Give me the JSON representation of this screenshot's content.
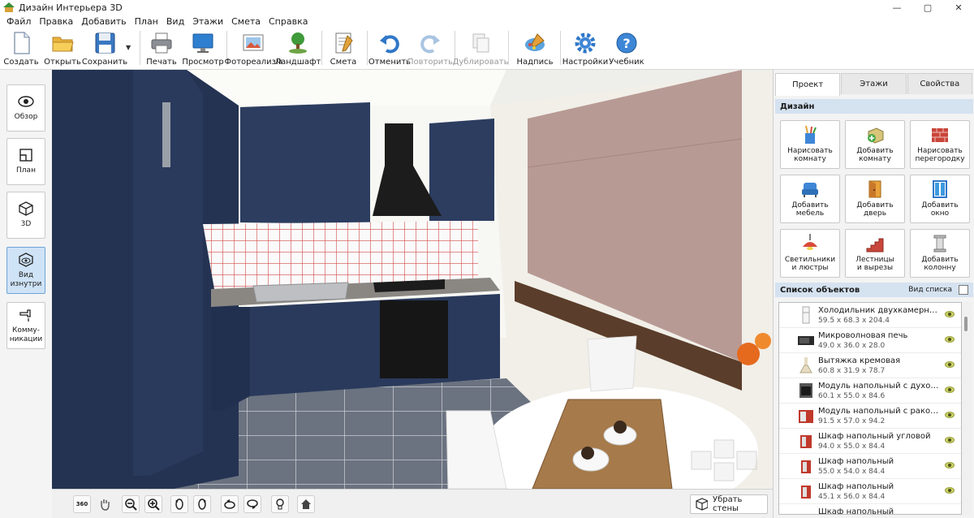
{
  "window": {
    "title": "Дизайн Интерьера 3D",
    "controls": [
      "—",
      "▢",
      "✕"
    ]
  },
  "menu": [
    "Файл",
    "Правка",
    "Добавить",
    "План",
    "Вид",
    "Этажи",
    "Смета",
    "Справка"
  ],
  "toolbar": {
    "create": "Создать",
    "open": "Открыть",
    "save": "Сохранить",
    "print": "Печать",
    "preview": "Просмотр",
    "photorealism": "Фотореализм",
    "landscape": "Ландшафт",
    "estimate": "Смета",
    "undo": "Отменить",
    "redo": "Повторить",
    "duplicate": "Дублировать",
    "caption": "Надпись",
    "settings": "Настройки",
    "tutorial": "Учебник"
  },
  "sidebar": {
    "items": [
      {
        "label": "Обзор",
        "icon": "eye-icon"
      },
      {
        "label": "План",
        "icon": "plan-icon"
      },
      {
        "label": "3D",
        "icon": "cube-icon"
      },
      {
        "label": "Вид\nизнутри",
        "icon": "inside-view-icon",
        "active": true
      },
      {
        "label": "Комму-\nникации",
        "icon": "faucet-icon"
      }
    ]
  },
  "panel": {
    "tabs": [
      "Проект",
      "Этажи",
      "Свойства"
    ],
    "active_tab": "Проект",
    "design_header": "Дизайн",
    "design_buttons": [
      "Нарисовать\nкомнату",
      "Добавить\nкомнату",
      "Нарисовать\nперегородку",
      "Добавить\nмебель",
      "Добавить\nдверь",
      "Добавить\nокно",
      "Светильники\nи люстры",
      "Лестницы\nи вырезы",
      "Добавить\nколонну"
    ],
    "list_header": "Список объектов",
    "list_view": "Вид списка",
    "objects": [
      {
        "name": "Холодильник двухкамерный бе...",
        "dims": "59.5 x 68.3 x 204.4"
      },
      {
        "name": "Микроволновая печь",
        "dims": "49.0 x 36.0 x 28.0"
      },
      {
        "name": "Вытяжка кремовая",
        "dims": "60.8 x 31.9 x 78.7"
      },
      {
        "name": "Модуль напольный с духовым ...",
        "dims": "60.1 x 55.0 x 84.6"
      },
      {
        "name": "Модуль напольный с раковиной",
        "dims": "91.5 x 57.0 x 94.2"
      },
      {
        "name": "Шкаф напольный угловой",
        "dims": "94.0 x 55.0 x 84.4"
      },
      {
        "name": "Шкаф напольный",
        "dims": "55.0 x 54.0 x 84.4"
      },
      {
        "name": "Шкаф напольный",
        "dims": "45.1 x 56.0 x 84.4"
      },
      {
        "name": "Шкаф напольный",
        "dims": ""
      }
    ]
  },
  "bottom": {
    "remove_walls": "Убрать стены",
    "rotate_label": "360"
  },
  "colors": {
    "cabinet": "#2b3a5a",
    "accent": "#3b78c4",
    "panel_header": "#d5e2f0"
  }
}
